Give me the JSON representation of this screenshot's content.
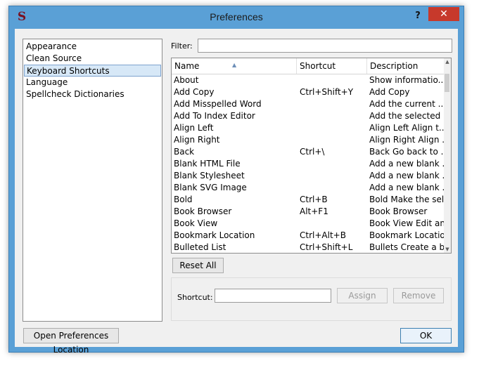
{
  "window": {
    "title": "Preferences",
    "help_label": "?",
    "close_label": "✕",
    "app_icon_glyph": "S"
  },
  "sidebar": {
    "items": [
      {
        "label": "Appearance",
        "selected": false
      },
      {
        "label": "Clean Source",
        "selected": false
      },
      {
        "label": "Keyboard Shortcuts",
        "selected": true
      },
      {
        "label": "Language",
        "selected": false
      },
      {
        "label": "Spellcheck Dictionaries",
        "selected": false
      }
    ]
  },
  "filter": {
    "label": "Filter:",
    "value": ""
  },
  "table": {
    "columns": [
      "Name",
      "Shortcut",
      "Description"
    ],
    "rows": [
      {
        "name": "About",
        "shortcut": "",
        "description": "Show informatio..."
      },
      {
        "name": "Add Copy",
        "shortcut": "Ctrl+Shift+Y",
        "description": "Add Copy"
      },
      {
        "name": "Add Misspelled Word",
        "shortcut": "",
        "description": "Add the current ..."
      },
      {
        "name": "Add To Index Editor",
        "shortcut": "",
        "description": "Add the selected ..."
      },
      {
        "name": "Align Left",
        "shortcut": "",
        "description": "Align Left Align t..."
      },
      {
        "name": "Align Right",
        "shortcut": "",
        "description": "Align Right Align ..."
      },
      {
        "name": "Back",
        "shortcut": "Ctrl+\\",
        "description": "Back Go back to ..."
      },
      {
        "name": "Blank HTML File",
        "shortcut": "",
        "description": "Add a new blank ..."
      },
      {
        "name": "Blank Stylesheet",
        "shortcut": "",
        "description": "Add a new blank ..."
      },
      {
        "name": "Blank SVG Image",
        "shortcut": "",
        "description": "Add a new blank ..."
      },
      {
        "name": "Bold",
        "shortcut": "Ctrl+B",
        "description": "Bold Make the sel..."
      },
      {
        "name": "Book Browser",
        "shortcut": "Alt+F1",
        "description": "Book Browser"
      },
      {
        "name": "Book View",
        "shortcut": "",
        "description": "Book View Edit an..."
      },
      {
        "name": "Bookmark Location",
        "shortcut": "Ctrl+Alt+B",
        "description": "Bookmark Location"
      },
      {
        "name": "Bulleted List",
        "shortcut": "Ctrl+Shift+L",
        "description": "Bullets Create a b..."
      }
    ]
  },
  "buttons": {
    "reset_all": "Reset All",
    "assign": "Assign",
    "remove": "Remove",
    "open_location": "Open Preferences Location",
    "ok": "OK"
  },
  "shortcut_editor": {
    "label": "Shortcut:",
    "value": ""
  }
}
